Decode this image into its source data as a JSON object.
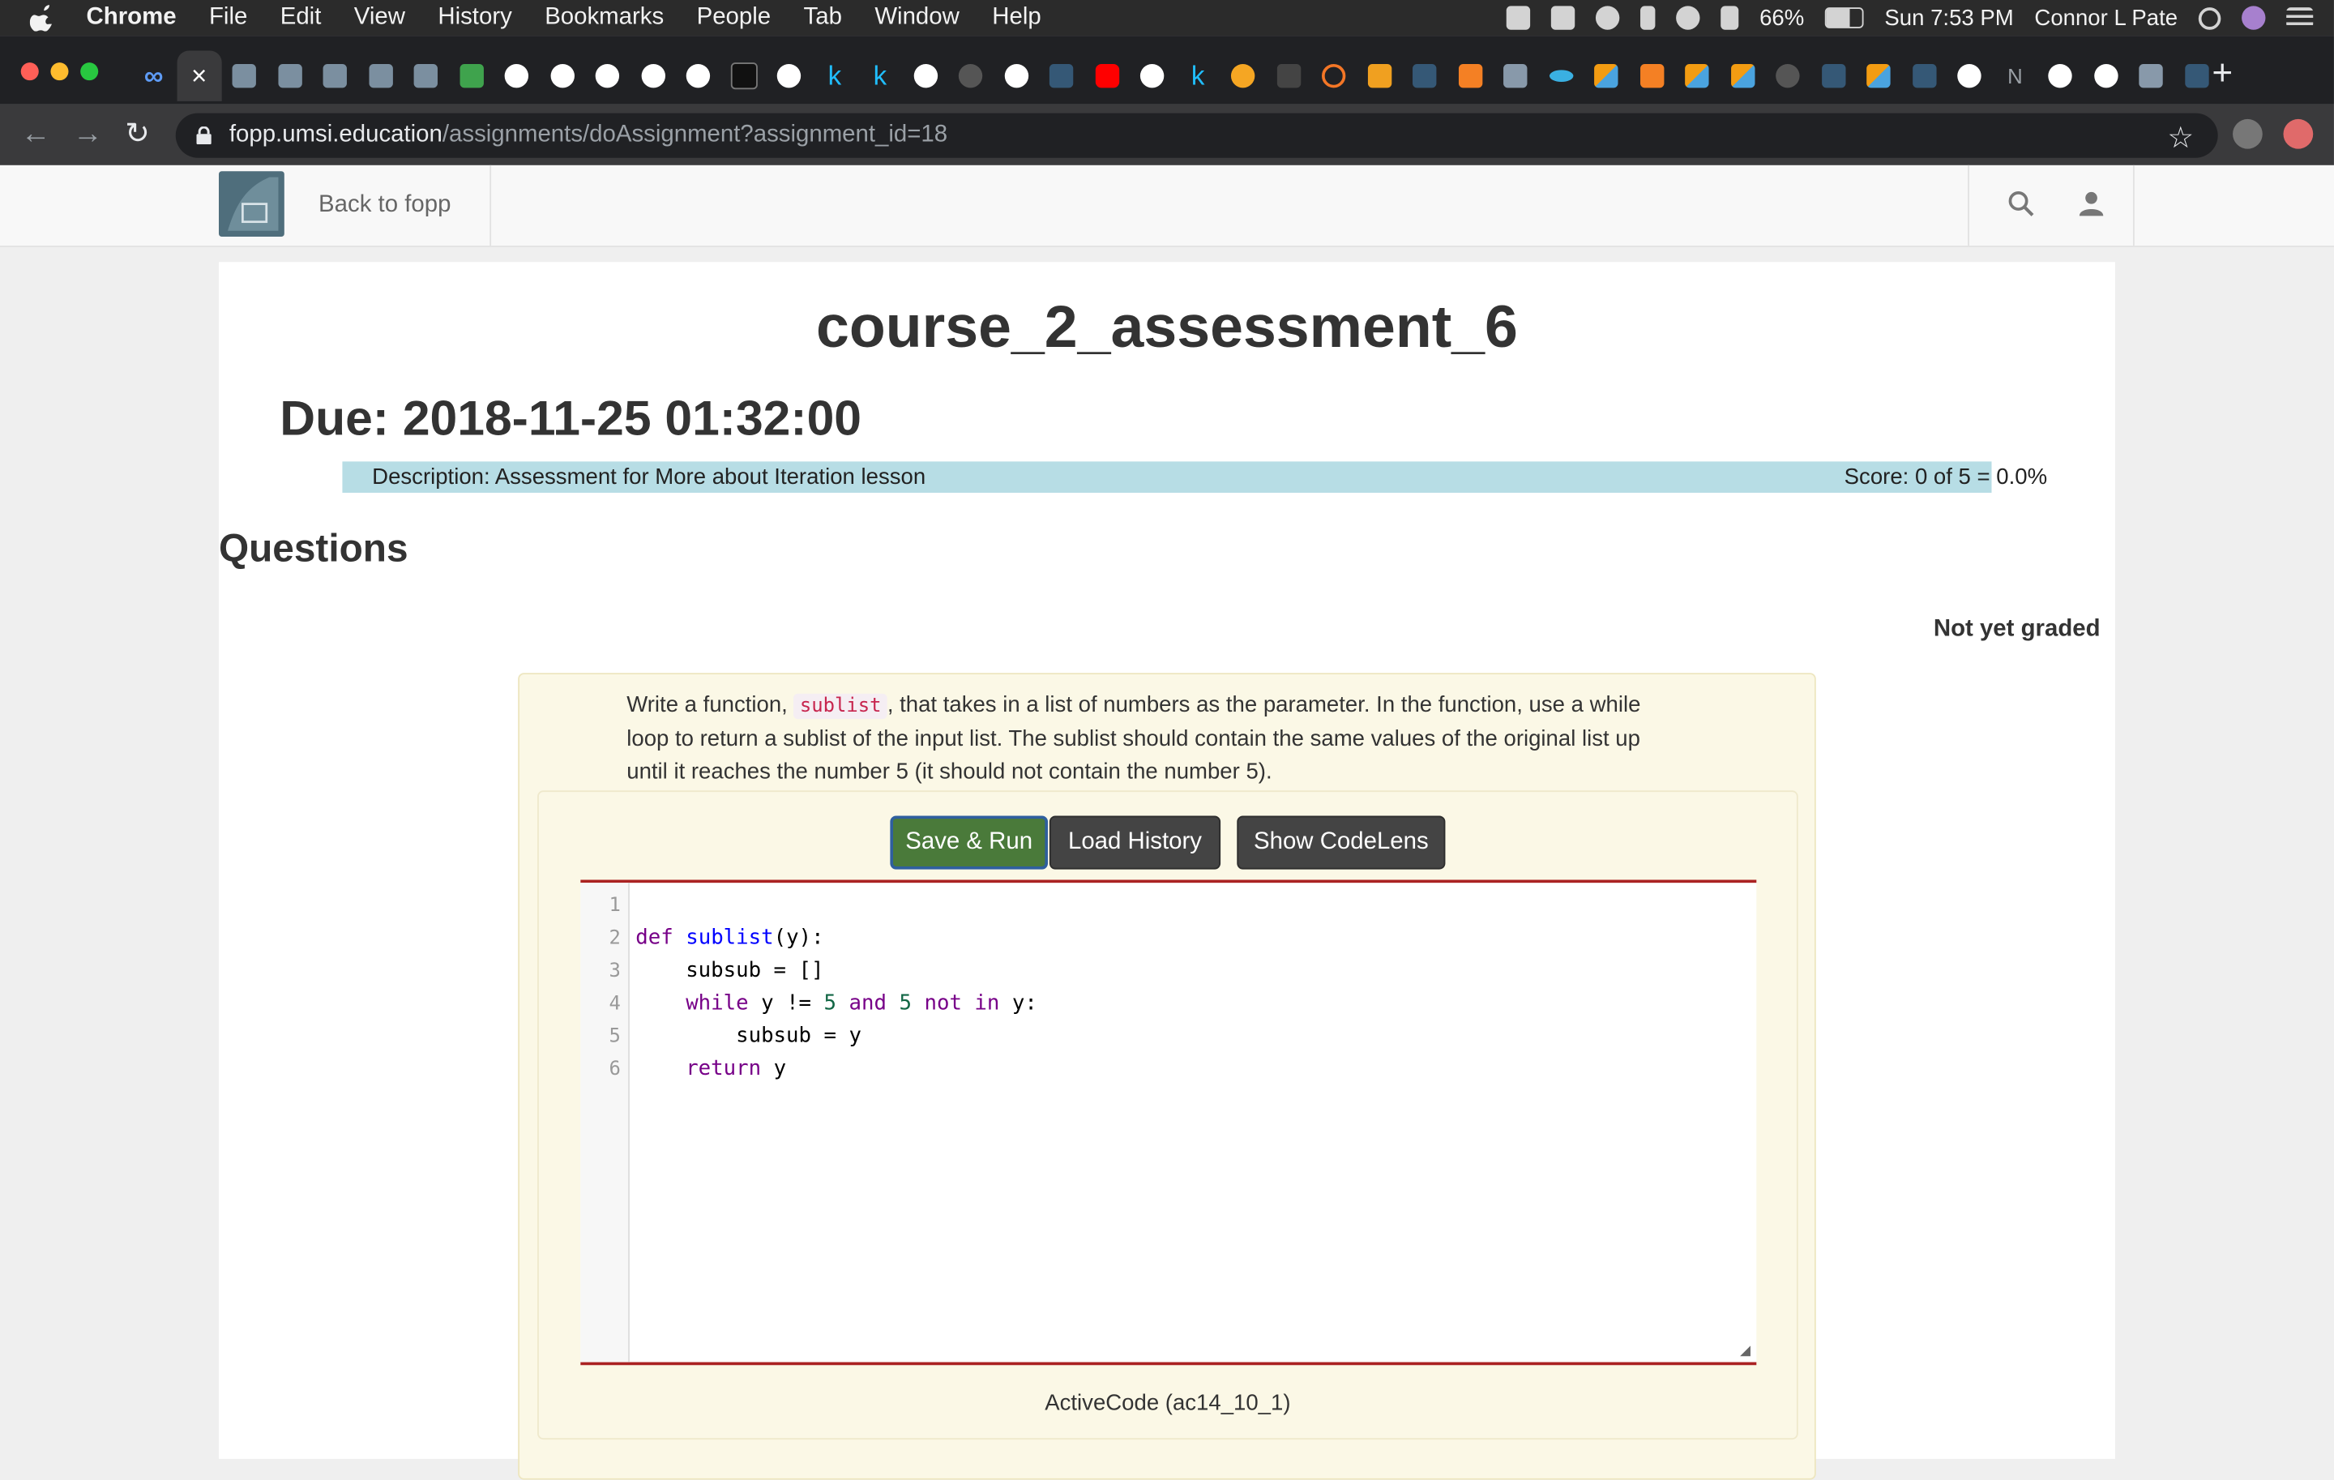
{
  "menubar": {
    "app": "Chrome",
    "items": [
      "File",
      "Edit",
      "View",
      "History",
      "Bookmarks",
      "People",
      "Tab",
      "Window",
      "Help"
    ],
    "battery": "66%",
    "clock": "Sun 7:53 PM",
    "user": "Connor L Pate"
  },
  "browser": {
    "url_host": "fopp.umsi.education",
    "url_path": "/assignments/doAssignment?assignment_id=18",
    "tab_text_N": "N"
  },
  "site": {
    "back_link": "Back to fopp"
  },
  "assignment": {
    "title": "course_2_assessment_6",
    "due": "Due: 2018-11-25 01:32:00",
    "description": "Description: Assessment for More about Iteration lesson",
    "score": "Score: 0 of 5 = 0.0%",
    "questions_heading": "Questions",
    "grade_status": "Not yet graded"
  },
  "question": {
    "text_before": "Write a function,",
    "code_word": "sublist",
    "text_after": ", that takes in a list of numbers as the parameter. In the function, use a while loop to return a sublist of the input list. The sublist should contain the same values of the original list up until it reaches the number 5 (it should not contain the number 5).",
    "buttons": {
      "save_run": "Save & Run",
      "load_history": "Load History",
      "show_codelens": "Show CodeLens"
    },
    "line_numbers": [
      "1",
      "2",
      "3",
      "4",
      "5",
      "6"
    ],
    "code": {
      "l2": {
        "kw": "def",
        "fn": "sublist",
        "rest": "(y):"
      },
      "l3": "    subsub = []",
      "l4": {
        "indent": "    ",
        "kw1": "while",
        "a": " y != ",
        "n1": "5",
        "sp1": " ",
        "kw2": "and",
        "sp2": " ",
        "n2": "5",
        "sp3": " ",
        "kw3": "not",
        "sp4": " ",
        "kw4": "in",
        "b": " y:"
      },
      "l5": "        subsub = y",
      "l6": {
        "indent": "    ",
        "kw": "return",
        "rest": " y"
      }
    },
    "caption": "ActiveCode (ac14_10_1)"
  },
  "colors": {
    "desc_bar": "#b7dde5",
    "save_button": "#4a7a3a",
    "editor_border": "#aa2222",
    "question_bg": "#fbf8e6"
  }
}
